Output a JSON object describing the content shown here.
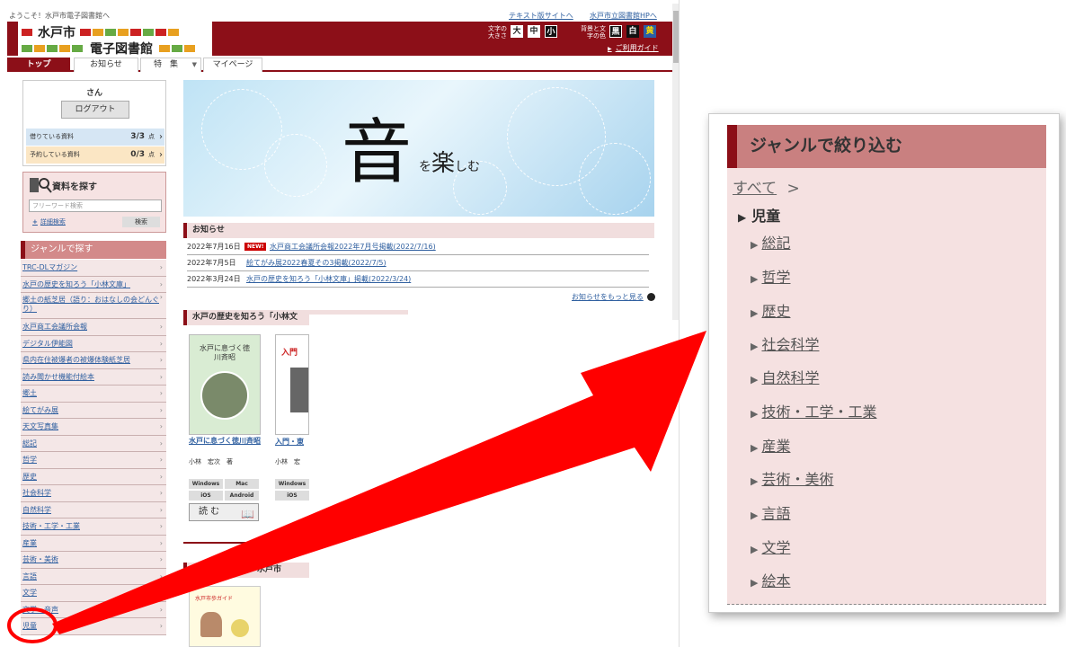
{
  "header": {
    "welcome": "ようこそ！水戸市電子図書館へ",
    "text_site_link": "テキスト版サイトへ",
    "library_hp_link": "水戸市立図書館HPへ",
    "logo_line1": "水戸市",
    "logo_line2": "電子図書館",
    "font_size_label": "文字の大きさ",
    "font_sizes": [
      "大",
      "中",
      "小"
    ],
    "color_label": "背景と文字の色",
    "colors": [
      "黒",
      "白",
      "黄"
    ],
    "guide_link": "ご利用ガイド",
    "brand_color": "#8c0f18"
  },
  "nav": {
    "tabs": [
      "トップ",
      "お知らせ",
      "特　集",
      "マイページ"
    ]
  },
  "user": {
    "name": "さん",
    "logout": "ログアウト",
    "borrowed_label": "借りている資料",
    "borrowed_count": "3/3",
    "reserved_label": "予約している資料",
    "reserved_count": "0/3",
    "count_unit": "点"
  },
  "search": {
    "title": "資料を探す",
    "placeholder": "フリーワード検索",
    "advanced": "詳細検索",
    "button": "検索"
  },
  "genres": {
    "title": "ジャンルで探す",
    "items": [
      "TRC-DLマガジン",
      "水戸の歴史を知ろう「小林文庫」",
      "郷土の紙芝居（語り：おはなしの会どんぐり）",
      "水戸商工会議所会報",
      "デジタル伊能図",
      "県内在住被爆者の被爆体験紙芝居",
      "読み聞かせ機能付絵本",
      "郷土",
      "絵てがみ展",
      "天文写真集",
      "総記",
      "哲学",
      "歴史",
      "社会科学",
      "自然科学",
      "技術・工学・工業",
      "産業",
      "芸術・美術",
      "言語",
      "文学",
      "文学・音声",
      "児童"
    ]
  },
  "hero": {
    "big": "音",
    "sub1": "を",
    "sub2": "楽",
    "sub3": "しむ"
  },
  "news": {
    "title": "お知らせ",
    "new_badge": "NEW!",
    "items": [
      {
        "date": "2022年7月16日",
        "text": "水戸商工会議所会報2022年7月号掲載(2022/7/16)"
      },
      {
        "date": "2022年7月5日",
        "text": "絵てがみ展2022春夏その3掲載(2022/7/5)"
      },
      {
        "date": "2022年3月24日",
        "text": "水戸の歴史を知ろう「小林文庫」掲載(2022/3/24)"
      }
    ],
    "more": "お知らせをもっと見る"
  },
  "feature": {
    "title": "水戸の歴史を知ろう「小林文",
    "cover_text": "水戸に息づく徳川斉昭",
    "book_title": "水戸に息づく徳川斉昭",
    "author": "小林　宏次　著",
    "book2_title": "入門・東",
    "author2": "小林　宏",
    "os": [
      "Windows",
      "Mac",
      "iOS",
      "Android"
    ],
    "read": "読 む",
    "cover2_text": "入門"
  },
  "feature2": {
    "title": "る学習に役立つ　水戸市",
    "guide_text": "水戸市歩ガイド"
  },
  "zoom": {
    "title": "ジャンルで絞り込む",
    "all": "すべて",
    "sep": ">",
    "current": "児童",
    "items": [
      "総記",
      "哲学",
      "歴史",
      "社会科学",
      "自然科学",
      "技術・工学・工業",
      "産業",
      "芸術・美術",
      "言語",
      "文学",
      "絵本"
    ]
  },
  "annotation": {
    "arrow_color": "#ff0000"
  }
}
